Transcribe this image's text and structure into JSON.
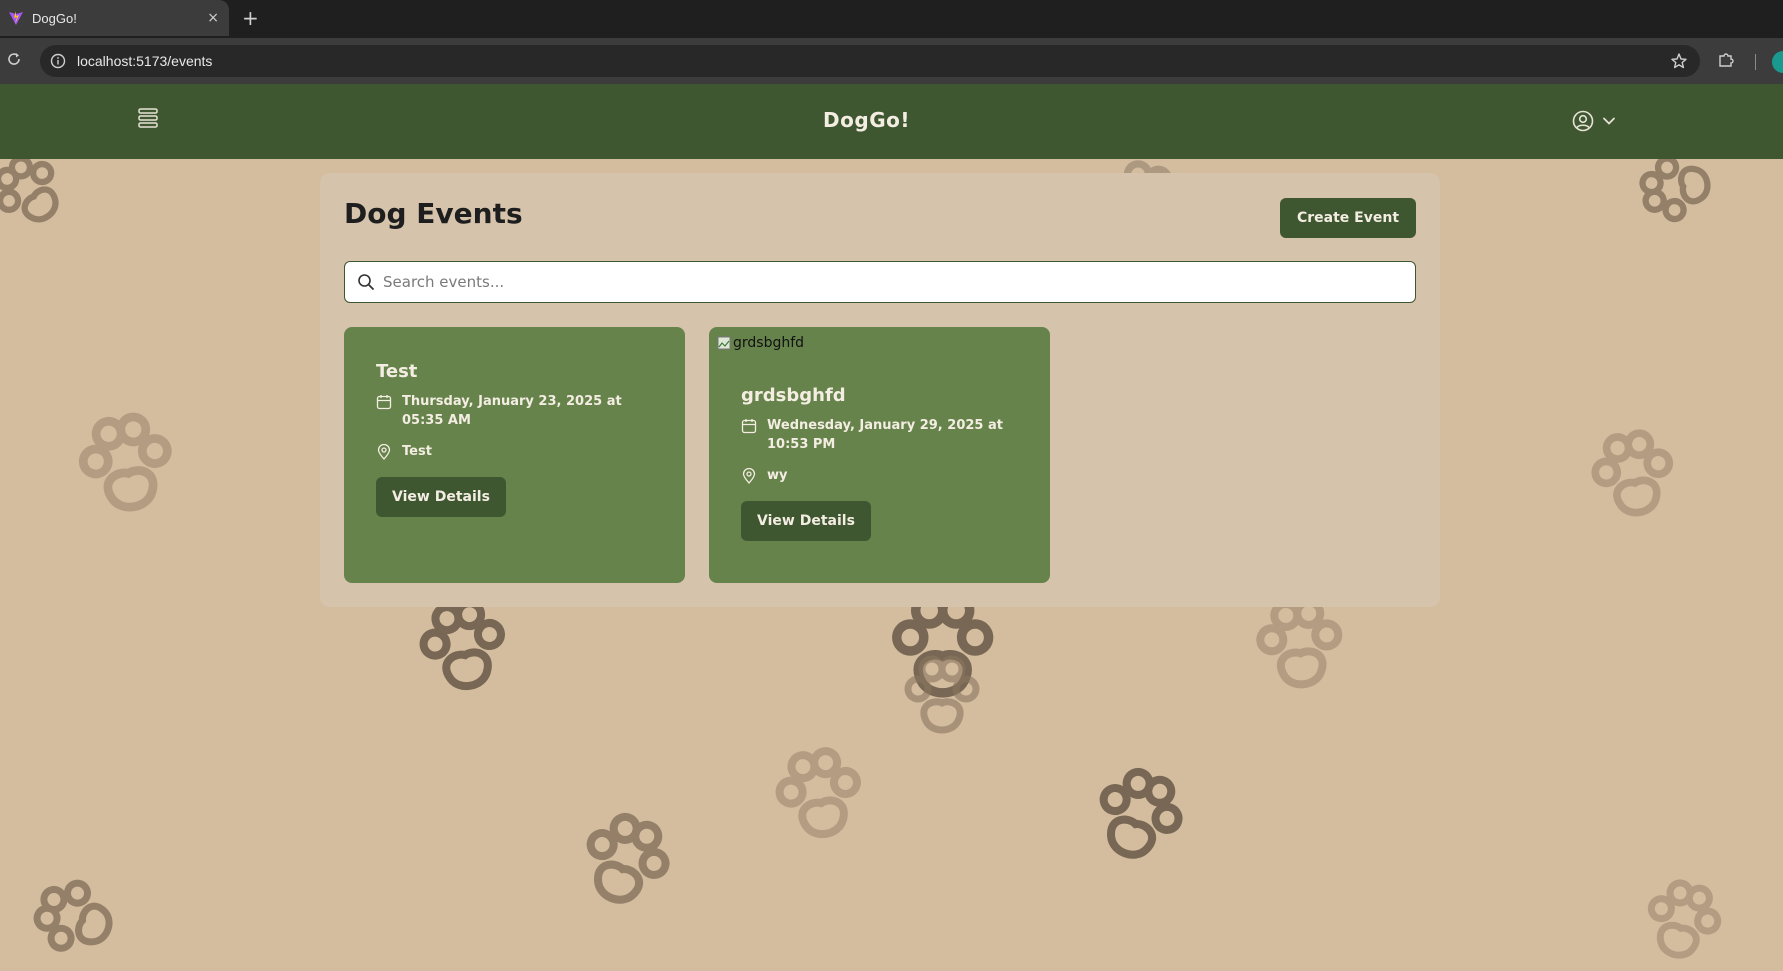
{
  "browser": {
    "tab_title": "DogGo!",
    "tab_close": "×",
    "new_tab": "+",
    "url": "localhost:5173/events"
  },
  "header": {
    "brand": "DogGo!"
  },
  "page": {
    "title": "Dog Events",
    "create_button": "Create Event",
    "search_placeholder": "Search events..."
  },
  "events": [
    {
      "title": "Test",
      "date": "Thursday, January 23, 2025 at 05:35 AM",
      "location": "Test",
      "button": "View Details"
    },
    {
      "image_alt": "grdsbghfd",
      "title": "grdsbghfd",
      "date": "Wednesday, January 29, 2025 at 10:53 PM",
      "location": "wy",
      "button": "View Details"
    }
  ],
  "colors": {
    "header_green": "#3e5731",
    "card_green": "#66834c",
    "background_tan": "#d4bd9f",
    "panel_tan": "#d6c3ab",
    "paw": "#8a7660"
  }
}
